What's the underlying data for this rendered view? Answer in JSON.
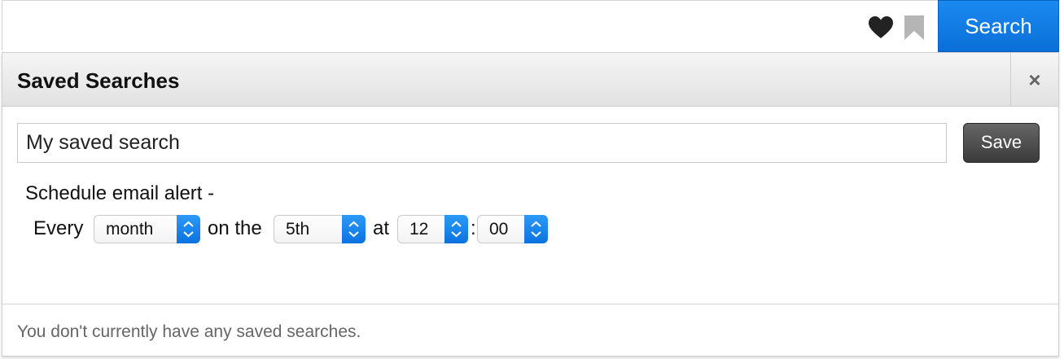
{
  "toolbar": {
    "search_label": "Search",
    "icons": [
      "heart-icon",
      "bookmark-icon"
    ]
  },
  "panel": {
    "title": "Saved Searches",
    "close_icon": "×",
    "name_input": {
      "value": "My saved search"
    },
    "save_label": "Save",
    "alert_label": "Schedule email alert -",
    "schedule": {
      "every_label": "Every",
      "frequency": "month",
      "on_the_label": "on the",
      "day": "5th",
      "at_label": "at",
      "hour": "12",
      "separator": ":",
      "minute": "00"
    },
    "empty_message": "You don't currently have any saved searches."
  },
  "colors": {
    "accent": "#0a6fd8",
    "save_button": "#3b3b3b"
  }
}
